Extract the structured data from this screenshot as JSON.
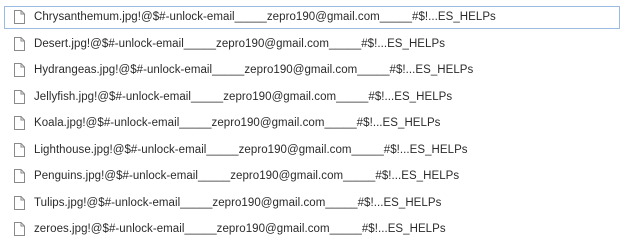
{
  "files": [
    {
      "name": "Chrysanthemum.jpg!@$#-unlock-email_____zepro190@gmail.com_____#$!...ES_HELPs",
      "icon": "document-icon",
      "selected": true
    },
    {
      "name": "Desert.jpg!@$#-unlock-email_____zepro190@gmail.com_____#$!...ES_HELPs",
      "icon": "document-icon"
    },
    {
      "name": "Hydrangeas.jpg!@$#-unlock-email_____zepro190@gmail.com_____#$!...ES_HELPs",
      "icon": "document-icon"
    },
    {
      "name": "Jellyfish.jpg!@$#-unlock-email_____zepro190@gmail.com_____#$!...ES_HELPs",
      "icon": "document-icon"
    },
    {
      "name": "Koala.jpg!@$#-unlock-email_____zepro190@gmail.com_____#$!...ES_HELPs",
      "icon": "document-icon"
    },
    {
      "name": "Lighthouse.jpg!@$#-unlock-email_____zepro190@gmail.com_____#$!...ES_HELPs",
      "icon": "document-icon"
    },
    {
      "name": "Penguins.jpg!@$#-unlock-email_____zepro190@gmail.com_____#$!...ES_HELPs",
      "icon": "document-icon"
    },
    {
      "name": "Tulips.jpg!@$#-unlock-email_____zepro190@gmail.com_____#$!...ES_HELPs",
      "icon": "document-icon"
    },
    {
      "name": "zeroes.jpg!@$#-unlock-email_____zepro190@gmail.com_____#$!...ES_HELPs",
      "icon": "document-icon"
    }
  ],
  "colors": {
    "selection_border": "#9bbbe3",
    "text": "#2b2b2b",
    "icon_stroke": "#8a8a8a",
    "icon_fill": "#ffffff"
  }
}
